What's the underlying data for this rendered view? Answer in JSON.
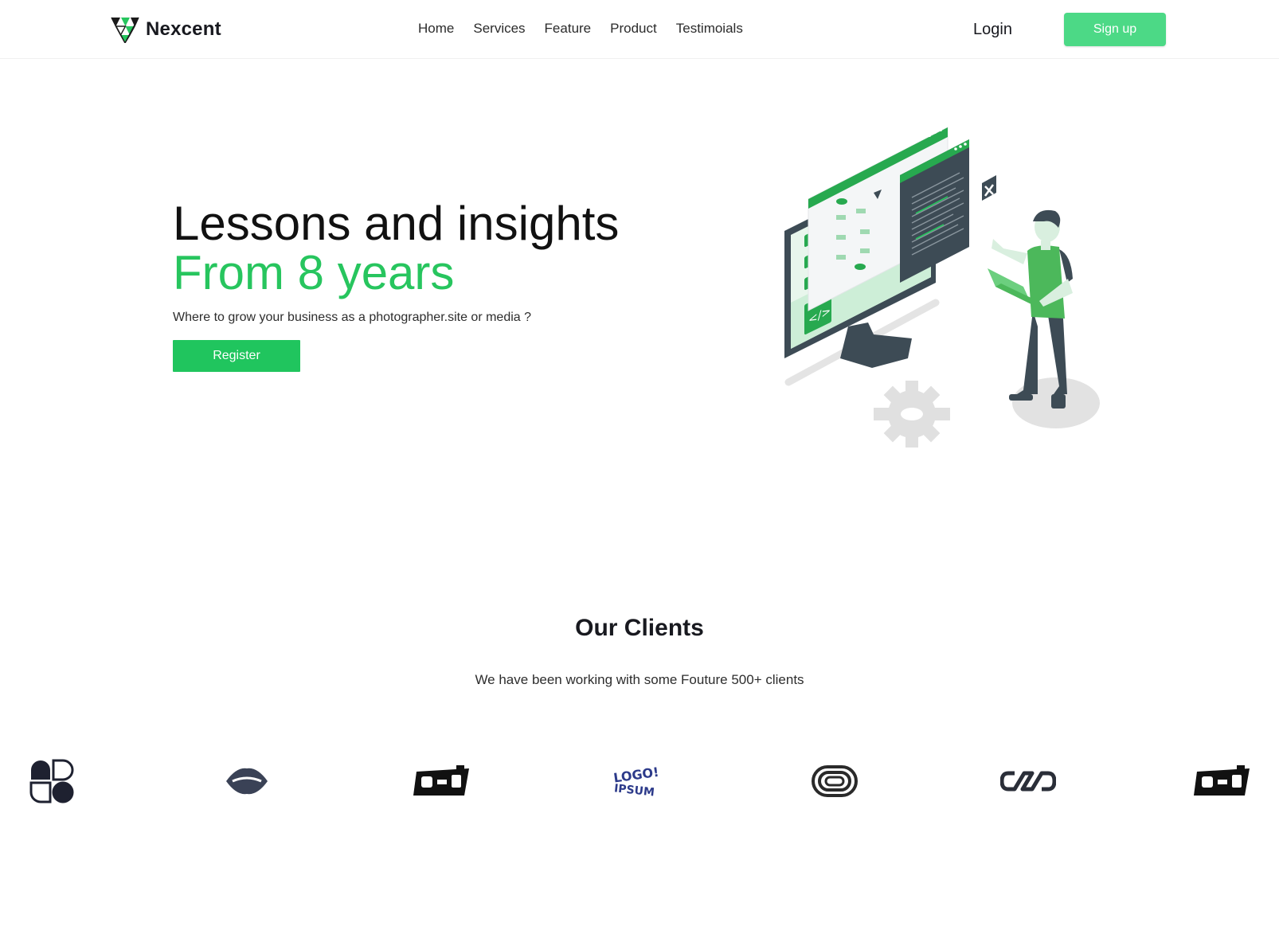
{
  "header": {
    "brand": "Nexcent",
    "nav": [
      "Home",
      "Services",
      "Feature",
      "Product",
      "Testimoials"
    ],
    "login_label": "Login",
    "signup_label": "Sign up"
  },
  "hero": {
    "title_line1": "Lessons and insights",
    "title_line2": "From 8 years",
    "subtitle": "Where to grow your business as a photographer.site or media ?",
    "register_label": "Register"
  },
  "clients": {
    "title": "Our Clients",
    "subtitle": "We have been working with some Fouture 500+ clients"
  },
  "colors": {
    "accent": "#4cd986",
    "primary_green": "#20c55e",
    "dark": "#18191f"
  }
}
